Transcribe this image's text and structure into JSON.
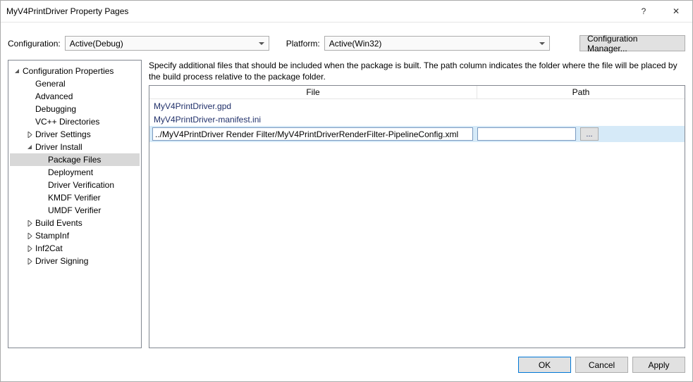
{
  "title": "MyV4PrintDriver Property Pages",
  "titlebar": {
    "help": "?",
    "close": "✕"
  },
  "config": {
    "label": "Configuration:",
    "value": "Active(Debug)",
    "platform_label": "Platform:",
    "platform_value": "Active(Win32)",
    "manager_btn": "Configuration Manager..."
  },
  "tree": {
    "root": "Configuration Properties",
    "items": [
      {
        "label": "General",
        "depth": 1
      },
      {
        "label": "Advanced",
        "depth": 1
      },
      {
        "label": "Debugging",
        "depth": 1
      },
      {
        "label": "VC++ Directories",
        "depth": 1
      },
      {
        "label": "Driver Settings",
        "depth": 1,
        "exp": "closed"
      },
      {
        "label": "Driver Install",
        "depth": 1,
        "exp": "open"
      },
      {
        "label": "Package Files",
        "depth": 2,
        "selected": true
      },
      {
        "label": "Deployment",
        "depth": 2
      },
      {
        "label": "Driver Verification",
        "depth": 2
      },
      {
        "label": "KMDF Verifier",
        "depth": 2
      },
      {
        "label": "UMDF Verifier",
        "depth": 2
      },
      {
        "label": "Build Events",
        "depth": 1,
        "exp": "closed"
      },
      {
        "label": "StampInf",
        "depth": 1,
        "exp": "closed"
      },
      {
        "label": "Inf2Cat",
        "depth": 1,
        "exp": "closed"
      },
      {
        "label": "Driver Signing",
        "depth": 1,
        "exp": "closed"
      }
    ]
  },
  "content": {
    "desc": "Specify additional files that should be included when the package is built.  The path column indicates the folder where the file will be placed by the build process relative to the package folder.",
    "headers": {
      "file": "File",
      "path": "Path"
    },
    "rows": [
      {
        "file": "MyV4PrintDriver.gpd"
      },
      {
        "file": "MyV4PrintDriver-manifest.ini"
      }
    ],
    "editing": {
      "file": "../MyV4PrintDriver Render Filter/MyV4PrintDriverRenderFilter-PipelineConfig.xml",
      "path": "",
      "browse": "..."
    }
  },
  "footer": {
    "ok": "OK",
    "cancel": "Cancel",
    "apply": "Apply"
  }
}
